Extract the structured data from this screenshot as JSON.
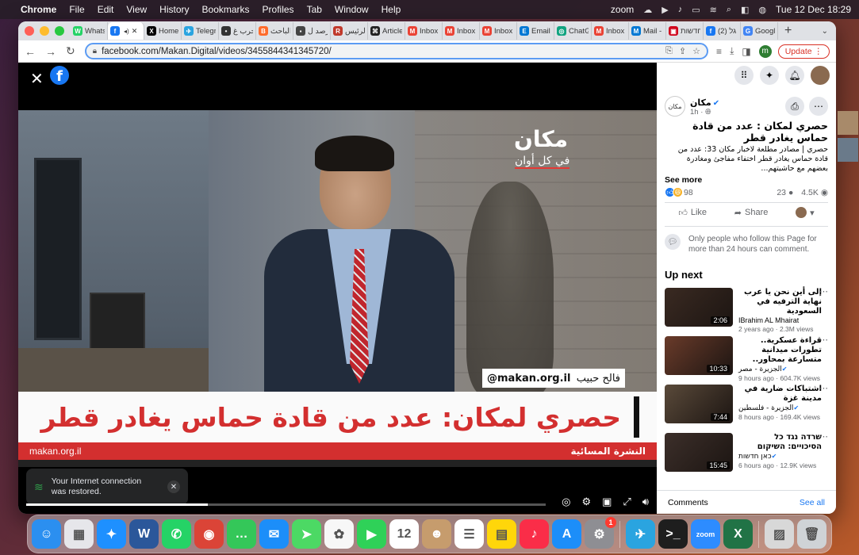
{
  "menubar": {
    "apple": "",
    "app": "Chrome",
    "items": [
      "File",
      "Edit",
      "View",
      "History",
      "Bookmarks",
      "Profiles",
      "Tab",
      "Window",
      "Help"
    ],
    "zoom": "zoom",
    "datetime": "Tue 12 Dec 18:29"
  },
  "tabs": [
    {
      "label": "WhatsApp",
      "color": "#25d366",
      "glyph": "W"
    },
    {
      "label": "",
      "color": "#1877f2",
      "glyph": "f",
      "active": true
    },
    {
      "label": "Home",
      "color": "#000000",
      "glyph": "X"
    },
    {
      "label": "Telegram",
      "color": "#2aa4e0",
      "glyph": "✈"
    },
    {
      "label": "حرب غ",
      "color": "#333333",
      "glyph": "•"
    },
    {
      "label": "الباحث",
      "color": "#ff6b2b",
      "glyph": "B"
    },
    {
      "label": "رصد ل",
      "color": "#444444",
      "glyph": "▪"
    },
    {
      "label": "الرئيس",
      "color": "#c0392b",
      "glyph": "R"
    },
    {
      "label": "Article",
      "color": "#222222",
      "glyph": "⌘"
    },
    {
      "label": "Inbox",
      "color": "#ea4335",
      "glyph": "M"
    },
    {
      "label": "Inbox",
      "color": "#ea4335",
      "glyph": "M"
    },
    {
      "label": "Inbox",
      "color": "#ea4335",
      "glyph": "M"
    },
    {
      "label": "Email",
      "color": "#0078d4",
      "glyph": "E"
    },
    {
      "label": "ChatGPT",
      "color": "#10a37f",
      "glyph": "◎"
    },
    {
      "label": "Inbox",
      "color": "#ea4335",
      "glyph": "M"
    },
    {
      "label": "Mail -",
      "color": "#0078d4",
      "glyph": "M"
    },
    {
      "label": "חדשות",
      "color": "#d0021b",
      "glyph": "▣"
    },
    {
      "label": "(2) גל",
      "color": "#1877f2",
      "glyph": "f"
    },
    {
      "label": "Google",
      "color": "#4285f4",
      "glyph": "G"
    }
  ],
  "address": {
    "url": "facebook.com/Makan.Digital/videos/3455844341345720/",
    "profile": "m",
    "update_label": "Update"
  },
  "video": {
    "logo_text": "مكان",
    "logo_sub": "في كل أوان",
    "name_caption": "فالح حبيب",
    "handle": "@makan.org.il",
    "headline": "حصري لمكان: عدد من قادة حماس يغادر قطر",
    "site": "makan.org.il",
    "program": "النشرة المسائية",
    "progress": 0.35
  },
  "toast": {
    "message": "Your Internet connection was restored."
  },
  "post": {
    "page_name": "مكان",
    "page_avatar": "مكان",
    "time": "1h · ",
    "title": "حصري لمكان : عدد من قادة حماس يغادر قطر",
    "description": "حصري | مصادر مطلعة لاخبار مكان 33: عدد من قادة حماس يغادر قطر اختفاء مفاجئ ومغادرة بعضهم مع حاشيتهم...",
    "see_more": "See more",
    "reactions": "98",
    "comments": "23",
    "views": "4.5K",
    "like": "Like",
    "share": "Share",
    "comment_notice": "Only people who follow this Page for more than 24 hours can comment."
  },
  "up_next": {
    "title": "Up next",
    "items": [
      {
        "title": "إلى أين نحن يا عرب نهاية الترفيه في السعودية",
        "author": "IBrahim AL Mhairat",
        "meta": "2 years ago · 2.3M views",
        "duration": "2:06",
        "thumb": "#3a2a22",
        "verified": false
      },
      {
        "title": "قراءة عسكرية.. تطورات ميدانية متسارعة بمحاور..",
        "author": "الجزيرة - مصر",
        "meta": "9 hours ago · 604.7K views",
        "duration": "10:33",
        "thumb": "#6a3b2a",
        "verified": true
      },
      {
        "title": "اشتباكات ضارية في مدينة غزة",
        "author": "الجزيرة - فلسطين",
        "meta": "8 hours ago · 169.4K views",
        "duration": "7:44",
        "thumb": "#5a4a3a",
        "verified": true
      },
      {
        "title": "שרדה נגד כל הסיכויים: השיקום",
        "author": "כאן חדשות",
        "meta": "6 hours ago · 12.9K views",
        "duration": "15:45",
        "thumb": "#3c2f2a",
        "verified": true
      }
    ]
  },
  "comments_bar": {
    "label": "Comments",
    "see_all": "See all"
  },
  "dock": [
    {
      "name": "finder",
      "color": "#2b8ff0",
      "glyph": "☺"
    },
    {
      "name": "launchpad",
      "color": "#e6e6ea",
      "glyph": "▦"
    },
    {
      "name": "safari",
      "color": "#1e90ff",
      "glyph": "✦"
    },
    {
      "name": "word",
      "color": "#2b579a",
      "glyph": "W"
    },
    {
      "name": "whatsapp",
      "color": "#25d366",
      "glyph": "✆"
    },
    {
      "name": "chrome",
      "color": "#db4437",
      "glyph": "◉"
    },
    {
      "name": "messages",
      "color": "#34c759",
      "glyph": "…"
    },
    {
      "name": "mail",
      "color": "#1c8ef9",
      "glyph": "✉"
    },
    {
      "name": "maps",
      "color": "#4cd964",
      "glyph": "➤"
    },
    {
      "name": "photos",
      "color": "#f7f7f7",
      "glyph": "✿"
    },
    {
      "name": "facetime",
      "color": "#2fd158",
      "glyph": "▶"
    },
    {
      "name": "calendar",
      "color": "#ffffff",
      "glyph": "12"
    },
    {
      "name": "contacts",
      "color": "#c69c6d",
      "glyph": "☻"
    },
    {
      "name": "reminders",
      "color": "#ffffff",
      "glyph": "☰"
    },
    {
      "name": "notes",
      "color": "#ffd60a",
      "glyph": "▤"
    },
    {
      "name": "music",
      "color": "#fa2d48",
      "glyph": "♪"
    },
    {
      "name": "app-store",
      "color": "#1c8ef9",
      "glyph": "A"
    },
    {
      "name": "system-settings",
      "color": "#8e8e93",
      "glyph": "⚙",
      "badge": "1"
    },
    {
      "name": "telegram",
      "color": "#2aa4e0",
      "glyph": "✈"
    },
    {
      "name": "terminal",
      "color": "#1e1e1e",
      "glyph": ">_"
    },
    {
      "name": "zoom",
      "color": "#2d8cff",
      "glyph": "zoom"
    },
    {
      "name": "excel",
      "color": "#217346",
      "glyph": "X"
    },
    {
      "name": "preview",
      "color": "#d8d8d8",
      "glyph": "▨"
    },
    {
      "name": "trash",
      "color": "#cfd3d6",
      "glyph": "🗑"
    }
  ],
  "colors": {
    "facebook_blue": "#1877f2",
    "makan_red": "#d32f2f",
    "update_red": "#d93025"
  }
}
